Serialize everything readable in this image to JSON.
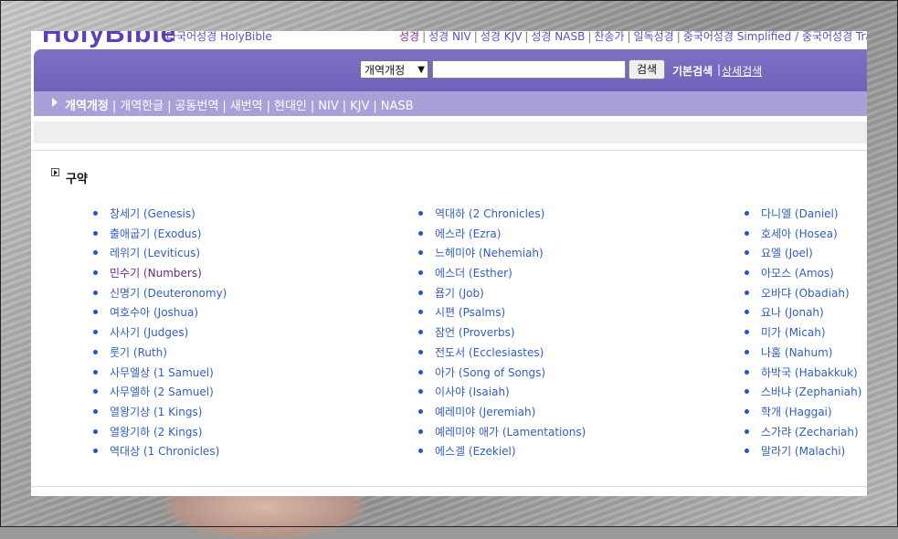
{
  "header": {
    "logo": "HolyBible",
    "logo_sub": "다국어성경 HolyBible",
    "links": [
      "성경",
      "성경 NIV",
      "성경 KJV",
      "성경 NASB",
      "찬송가",
      "일독성경",
      "중국어성경 Simplified / 중국어성경 Tra"
    ]
  },
  "search": {
    "version_selected": "개역개정",
    "button_label": "검색",
    "basic_label": "기본검색",
    "advanced_label": "상세검색"
  },
  "versions": [
    "개역개정",
    "개역한글",
    "공동번역",
    "새번역",
    "현대인",
    "NIV",
    "KJV",
    "NASB"
  ],
  "section": {
    "title": "구약"
  },
  "books": {
    "col1": [
      "창세기 (Genesis)",
      "출애굽기 (Exodus)",
      "레위기 (Leviticus)",
      "민수기 (Numbers)",
      "신명기 (Deuteronomy)",
      "여호수아 (Joshua)",
      "사사기 (Judges)",
      "룻기 (Ruth)",
      "사무엘상 (1 Samuel)",
      "사무엘하 (2 Samuel)",
      "열왕기상 (1 Kings)",
      "열왕기하 (2 Kings)",
      "역대상 (1 Chronicles)"
    ],
    "col2": [
      "역대하 (2 Chronicles)",
      "에스라 (Ezra)",
      "느헤미야 (Nehemiah)",
      "에스더 (Esther)",
      "욥기 (Job)",
      "시편 (Psalms)",
      "잠언 (Proverbs)",
      "전도서 (Ecclesiastes)",
      "아가 (Song of Songs)",
      "이사야 (Isaiah)",
      "예레미야 (Jeremiah)",
      "예레미야 애가 (Lamentations)",
      "에스겔 (Ezekiel)"
    ],
    "col3": [
      "다니엘 (Daniel)",
      "호세아 (Hosea)",
      "요엘 (Joel)",
      "아모스 (Amos)",
      "오바댜 (Obadiah)",
      "요나 (Jonah)",
      "미가 (Micah)",
      "나훔 (Nahum)",
      "하박국 (Habakkuk)",
      "스바냐 (Zephaniah)",
      "학개 (Haggai)",
      "스가랴 (Zechariah)",
      "말라기 (Malachi)"
    ]
  },
  "colors": {
    "search_bar": "#7468bf",
    "version_bar": "#a8a0d9",
    "link": "#2f5fc4",
    "visited_link": "#6b2a8a"
  }
}
